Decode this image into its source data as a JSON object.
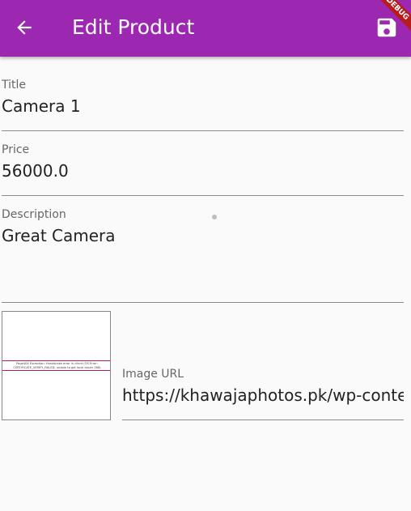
{
  "appbar": {
    "title": "Edit Product",
    "back_icon": "arrow-left-icon",
    "save_icon": "save-icon",
    "banner": "DEBUG",
    "color": "#9c27b0"
  },
  "form": {
    "title": {
      "label": "Title",
      "value": "Camera 1"
    },
    "price": {
      "label": "Price",
      "value": "56000.0"
    },
    "description": {
      "label": "Description",
      "value": "Great Camera"
    },
    "image_url": {
      "label": "Image URL",
      "value": "https://khawajaphotos.pk/wp-content"
    }
  },
  "preview": {
    "text_lines": [
      "Page404 Exception: Handshake error in client (OS Error:",
      "CERTIFICATE_VERIFY_FAILED: unable to get local issuer 268)"
    ]
  }
}
